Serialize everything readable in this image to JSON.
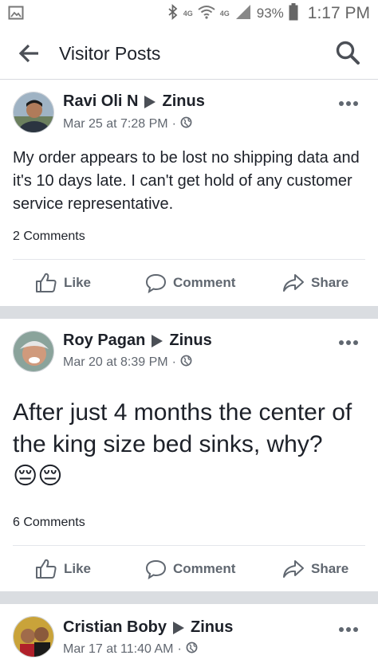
{
  "status_bar": {
    "network_1": "4G",
    "network_2": "4G",
    "battery": "93%",
    "time": "1:17 PM"
  },
  "header": {
    "title": "Visitor Posts"
  },
  "actions": {
    "like": "Like",
    "comment": "Comment",
    "share": "Share"
  },
  "posts": [
    {
      "author": "Ravi Oli N",
      "target": "Zinus",
      "timestamp": "Mar 25 at 7:28 PM",
      "separator": "·",
      "text": "My order appears to be lost no shipping data and it's 10 days late. I can't get hold of any customer service representative.",
      "comments": "2 Comments"
    },
    {
      "author": "Roy Pagan",
      "target": "Zinus",
      "timestamp": "Mar 20 at 8:39 PM",
      "separator": "·",
      "text": "After just 4 months the center of the king size bed sinks, why?",
      "emojis": "😔😔",
      "comments": "6 Comments"
    },
    {
      "author": "Cristian Boby",
      "target": "Zinus",
      "timestamp": "Mar 17 at 11:40 AM",
      "separator": "·"
    }
  ]
}
